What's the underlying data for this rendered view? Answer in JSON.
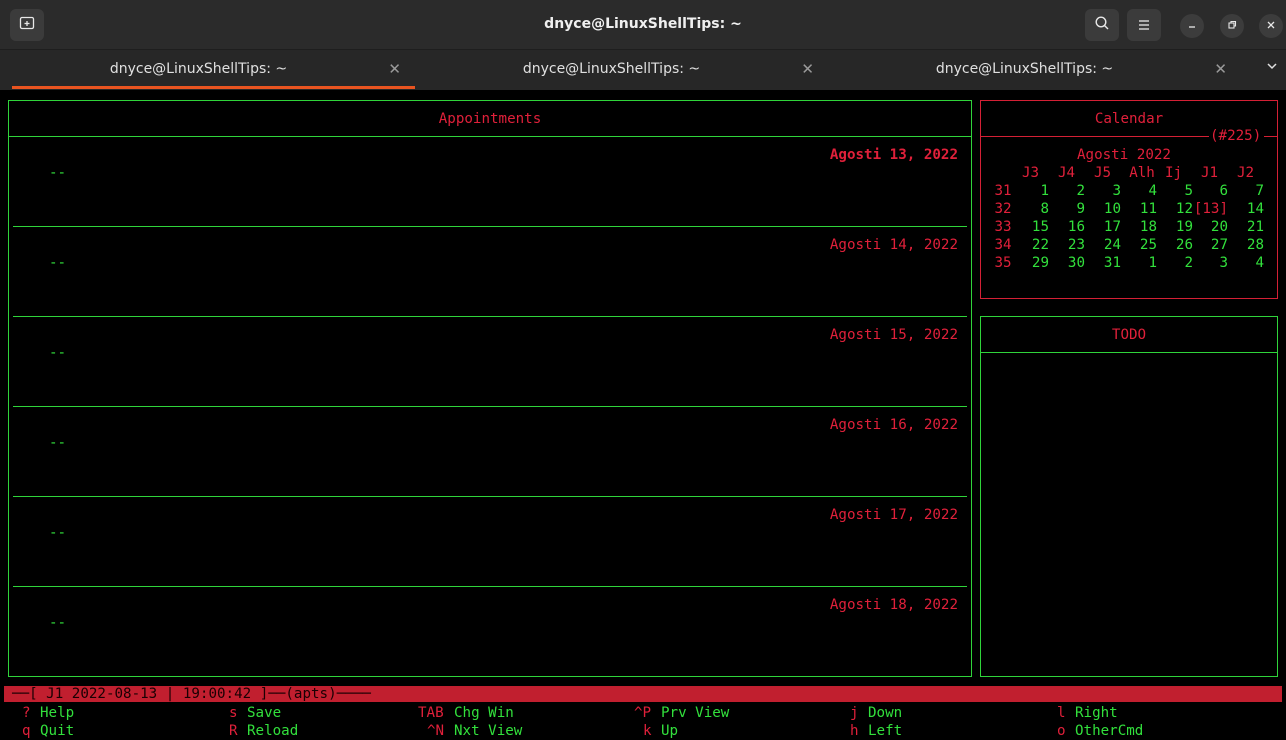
{
  "window": {
    "title": "dnyce@LinuxShellTips: ~"
  },
  "tabs": [
    {
      "label": "dnyce@LinuxShellTips: ~",
      "active": true
    },
    {
      "label": "dnyce@LinuxShellTips: ~",
      "active": false
    },
    {
      "label": "dnyce@LinuxShellTips: ~",
      "active": false
    }
  ],
  "icons": {
    "new_tab": "new-tab-icon",
    "search": "search-icon",
    "menu": "hamburger-menu-icon",
    "minimize": "minimize-icon",
    "restore": "restore-icon",
    "close": "close-icon",
    "tab_close": "close-icon",
    "tab_overflow": "chevron-down-icon"
  },
  "colors": {
    "accent": "#e95420",
    "terminal_red": "#e0203a",
    "terminal_green": "#32e03c",
    "statusbar": "#c11f2f"
  },
  "appointments": {
    "title": "Appointments",
    "days": [
      {
        "date": "Agosti 13, 2022",
        "entry": "--",
        "today": true
      },
      {
        "date": "Agosti 14, 2022",
        "entry": "--",
        "today": false
      },
      {
        "date": "Agosti 15, 2022",
        "entry": "--",
        "today": false
      },
      {
        "date": "Agosti 16, 2022",
        "entry": "--",
        "today": false
      },
      {
        "date": "Agosti 17, 2022",
        "entry": "--",
        "today": false
      },
      {
        "date": "Agosti 18, 2022",
        "entry": "--",
        "today": false
      }
    ]
  },
  "calendar": {
    "title": "Calendar",
    "counter": "(#225)",
    "month": "Agosti 2022",
    "weekdays": [
      "J3",
      "J4",
      "J5",
      "Alh",
      "Ij",
      "J1",
      "J2"
    ],
    "weeks": [
      {
        "num": "31",
        "days": [
          "1",
          "2",
          "3",
          "4",
          "5",
          "6",
          "7"
        ]
      },
      {
        "num": "32",
        "days": [
          "8",
          "9",
          "10",
          "11",
          "12",
          "[13]",
          "14"
        ]
      },
      {
        "num": "33",
        "days": [
          "15",
          "16",
          "17",
          "18",
          "19",
          "20",
          "21"
        ]
      },
      {
        "num": "34",
        "days": [
          "22",
          "23",
          "24",
          "25",
          "26",
          "27",
          "28"
        ]
      },
      {
        "num": "35",
        "days": [
          "29",
          "30",
          "31",
          "1",
          "2",
          "3",
          "4"
        ]
      }
    ]
  },
  "todo": {
    "title": "TODO"
  },
  "status": {
    "text": "[ J1 2022-08-13 | 19:00:42 ]",
    "mode": "(apts)"
  },
  "keys": [
    {
      "key": "?",
      "action": "Help"
    },
    {
      "key": "s",
      "action": "Save"
    },
    {
      "key": "TAB",
      "action": "Chg Win"
    },
    {
      "key": "^P",
      "action": "Prv View"
    },
    {
      "key": "j",
      "action": "Down"
    },
    {
      "key": "l",
      "action": "Right"
    },
    {
      "key": "q",
      "action": "Quit"
    },
    {
      "key": "R",
      "action": "Reload"
    },
    {
      "key": "^N",
      "action": "Nxt View"
    },
    {
      "key": "k",
      "action": "Up"
    },
    {
      "key": "h",
      "action": "Left"
    },
    {
      "key": "o",
      "action": "OtherCmd"
    }
  ]
}
